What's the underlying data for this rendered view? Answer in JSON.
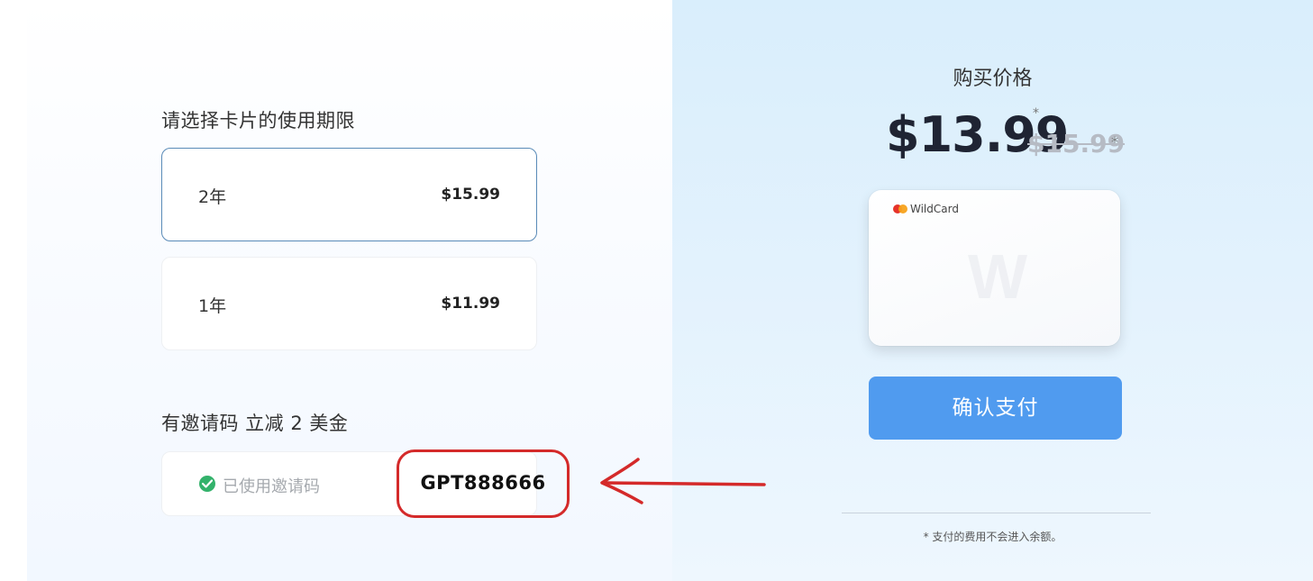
{
  "duration": {
    "title": "请选择卡片的使用期限",
    "options": [
      {
        "label": "2年",
        "price": "$15.99",
        "selected": true
      },
      {
        "label": "1年",
        "price": "$11.99",
        "selected": false
      }
    ]
  },
  "invite": {
    "title": "有邀请码 立减 2 美金",
    "status": "已使用邀请码",
    "code": "GPT888666"
  },
  "purchase": {
    "title": "购买价格",
    "price": "$13.99",
    "price_star": "*",
    "original_price": "$15.99",
    "original_star": "*",
    "card_brand": "WildCard",
    "card_watermark": "W",
    "pay_button": "确认支付",
    "footnote": "* 支付的费用不会进入余额。"
  },
  "colors": {
    "accent": "#509bef",
    "selected_border": "#5a8bb8",
    "annotation": "#d42a2a",
    "success": "#33b26b"
  },
  "icons": [
    "check-circle-icon",
    "mastercard-icon",
    "arrow-left-annotation-icon"
  ]
}
